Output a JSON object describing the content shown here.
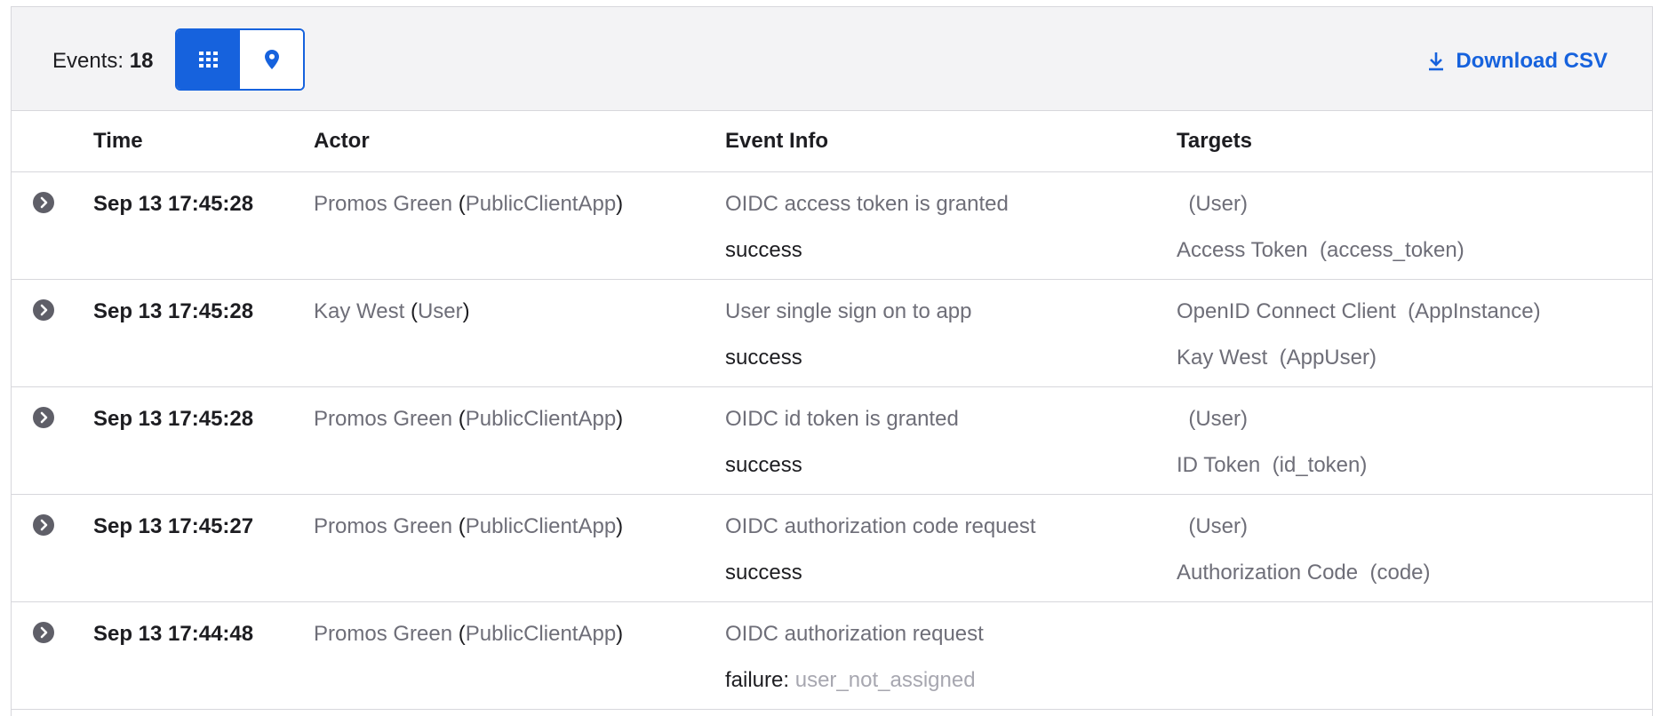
{
  "toolbar": {
    "events_label": "Events:",
    "events_count": "18",
    "download_label": "Download CSV"
  },
  "colors": {
    "accent": "#1662dd",
    "muted": "#6e6e78",
    "border": "#d7d7dc"
  },
  "icons": {
    "grid_view": "grid-icon",
    "map_view": "map-pin-icon",
    "download": "download-icon",
    "expand": "chevron-right-circle-icon"
  },
  "table": {
    "headers": {
      "time": "Time",
      "actor": "Actor",
      "event_info": "Event Info",
      "targets": "Targets"
    },
    "rows": [
      {
        "time": "Sep 13 17:45:28",
        "actor_name": "Promos Green",
        "actor_type": "PublicClientApp",
        "event": "OIDC access token is granted",
        "status": "success",
        "reason": "",
        "targets": [
          {
            "name": "",
            "type": "(User)"
          },
          {
            "name": "Access Token",
            "type": "(access_token)"
          }
        ]
      },
      {
        "time": "Sep 13 17:45:28",
        "actor_name": "Kay West",
        "actor_type": "User",
        "event": "User single sign on to app",
        "status": "success",
        "reason": "",
        "targets": [
          {
            "name": "OpenID Connect Client",
            "type": "(AppInstance)"
          },
          {
            "name": "Kay West",
            "type": "(AppUser)"
          }
        ]
      },
      {
        "time": "Sep 13 17:45:28",
        "actor_name": "Promos Green",
        "actor_type": "PublicClientApp",
        "event": "OIDC id token is granted",
        "status": "success",
        "reason": "",
        "targets": [
          {
            "name": "",
            "type": "(User)"
          },
          {
            "name": "ID Token",
            "type": "(id_token)"
          }
        ]
      },
      {
        "time": "Sep 13 17:45:27",
        "actor_name": "Promos Green",
        "actor_type": "PublicClientApp",
        "event": "OIDC authorization code request",
        "status": "success",
        "reason": "",
        "targets": [
          {
            "name": "",
            "type": "(User)"
          },
          {
            "name": "Authorization Code",
            "type": "(code)"
          }
        ]
      },
      {
        "time": "Sep 13 17:44:48",
        "actor_name": "Promos Green",
        "actor_type": "PublicClientApp",
        "event": "OIDC authorization request",
        "status": "failure",
        "reason": "user_not_assigned",
        "targets": []
      }
    ]
  }
}
